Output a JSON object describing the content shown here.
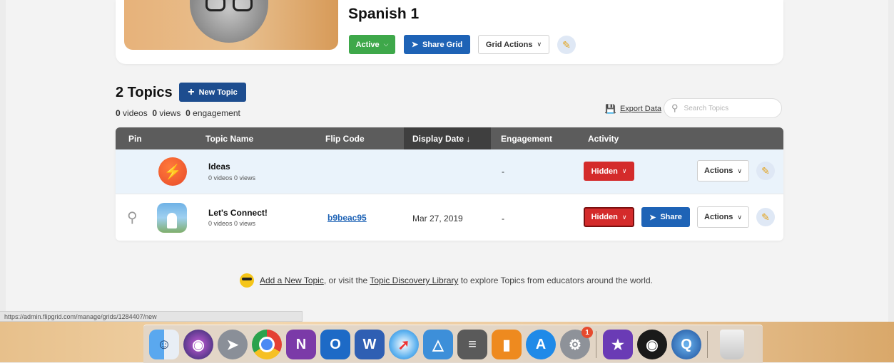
{
  "grid": {
    "title": "Spanish 1",
    "status_label": "Active",
    "share_label": "Share Grid",
    "actions_label": "Grid Actions"
  },
  "topics": {
    "title": "2 Topics",
    "new_topic_label": "New Topic",
    "stats": {
      "videos_count": "0",
      "videos_label": "videos",
      "views_count": "0",
      "views_label": "views",
      "engagement_count": "0",
      "engagement_label": "engagement"
    },
    "export_label": "Export Data",
    "search_placeholder": "Search Topics"
  },
  "table": {
    "columns": [
      "Pin",
      "Topic Name",
      "Flip Code",
      "Display Date ↓",
      "Engagement",
      "Activity"
    ],
    "rows": [
      {
        "name": "Ideas",
        "sub": "0 videos  0 views",
        "flip_code": "",
        "display_date": "",
        "engagement": "-",
        "activity": "Hidden",
        "share": "",
        "actions": "Actions"
      },
      {
        "name": "Let's Connect!",
        "sub": "0 videos  0 views",
        "flip_code": "b9beac95",
        "display_date": "Mar 27, 2019",
        "engagement": "-",
        "activity": "Hidden",
        "share": "Share",
        "actions": "Actions"
      }
    ]
  },
  "footer": {
    "link1": "Add a New Topic",
    "text1": ", or visit the ",
    "link2": "Topic Discovery Library",
    "text2": " to explore Topics from educators around the world."
  },
  "status_url": "https://admin.flipgrid.com/manage/grids/1284407/new",
  "dock": {
    "items": [
      "finder-icon",
      "siri-icon",
      "launchpad-icon",
      "chrome-icon",
      "onenote-icon",
      "outlook-icon",
      "word-icon",
      "safari-icon",
      "keynote-icon",
      "calculator-icon",
      "books-icon",
      "app-store-icon",
      "system-preferences-icon",
      "imovie-icon",
      "obs-icon",
      "quicktime-icon",
      "trash-icon"
    ],
    "badge": "1"
  },
  "colors": {
    "active_green": "#3ea84a",
    "share_blue": "#1e63b6",
    "hidden_red": "#d42b2b",
    "header_gray": "#5c5c5c"
  }
}
